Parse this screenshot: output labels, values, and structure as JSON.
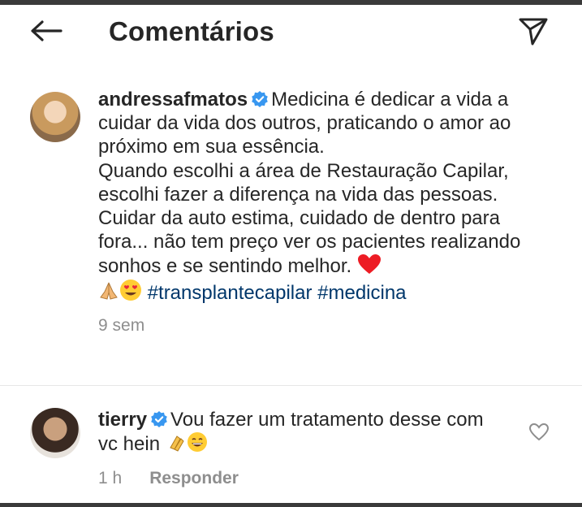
{
  "header": {
    "title": "Comentários",
    "back_icon": "arrow-left-icon",
    "send_icon": "paper-plane-icon"
  },
  "caption": {
    "username": "andressafmatos",
    "verified": true,
    "lines": [
      "Medicina é dedicar a vida a cuidar da vida dos outros, praticando o amor ao próximo em sua essência.",
      "Quando escolhi a área de Restauração Capilar, escolhi fazer a diferença na vida das pessoas.",
      "Cuidar da auto estima, cuidado de dentro para fora... não tem preço ver os pacientes realizando sonhos e se sentindo melhor."
    ],
    "hashtags": "#transplantecapilar #medicina",
    "time": "9 sem"
  },
  "reply": {
    "username": "tierry",
    "verified": true,
    "text": "Vou fazer um tratamento desse com vc hein",
    "time": "1 h",
    "reply_label": "Responder"
  },
  "colors": {
    "verified": "#3897f0",
    "hashtag": "#00376b",
    "meta": "#8e8e8e",
    "heart": "#ed1c24"
  }
}
